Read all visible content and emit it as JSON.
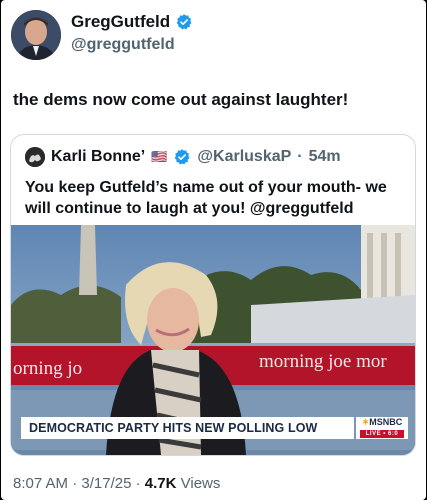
{
  "author": {
    "display_name": "GregGutfeld",
    "handle": "@greggutfeld",
    "verified_icon": "verified-badge-icon"
  },
  "tweet": {
    "text": "the dems now come out against laughter!"
  },
  "quoted_tweet": {
    "display_name": "Karli Bonne’",
    "flag": "🇺🇸",
    "handle": "@KarluskaP",
    "time_separator": "·",
    "time": "54m",
    "text": "You keep Gutfeld’s name out of your mouth- we will continue to laugh at you! @greggutfeld",
    "media": {
      "chyron": "DEMOCRATIC PARTY HITS NEW POLLING LOW",
      "network": "MSNBC",
      "live_label": "LIVE • 6:0",
      "banner_left": "orning jo",
      "banner_right": "morning joe  mor"
    }
  },
  "meta": {
    "time": "8:07 AM",
    "sep1": " · ",
    "date": "3/17/25",
    "sep2": " · ",
    "views": "4.7K",
    "views_label": " Views"
  },
  "colors": {
    "verified": "#1d9bf0",
    "text_primary": "#0f1419",
    "text_secondary": "#536471",
    "border": "#cfd9de"
  }
}
